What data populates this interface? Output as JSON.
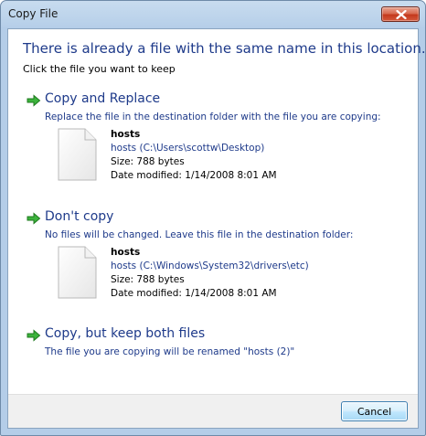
{
  "window": {
    "title": "Copy File"
  },
  "header": {
    "heading": "There is already a file with the same name in this location.",
    "subheading": "Click the file you want to keep"
  },
  "options": [
    {
      "title": "Copy and Replace",
      "description": "Replace the file in the destination folder with the file you are copying:",
      "file": {
        "name": "hosts",
        "path": "hosts (C:\\Users\\scottw\\Desktop)",
        "size": "Size: 788 bytes",
        "modified": "Date modified: 1/14/2008 8:01 AM"
      }
    },
    {
      "title": "Don't copy",
      "description": "No files will be changed. Leave this file in the destination folder:",
      "file": {
        "name": "hosts",
        "path": "hosts (C:\\Windows\\System32\\drivers\\etc)",
        "size": "Size: 788 bytes",
        "modified": "Date modified: 1/14/2008 8:01 AM"
      }
    },
    {
      "title": "Copy, but keep both files",
      "description": "The file you are copying will be renamed \"hosts (2)\""
    }
  ],
  "footer": {
    "cancel_label": "Cancel"
  },
  "colors": {
    "link_blue": "#1e3a8a",
    "arrow_green": "#2e9e2e",
    "close_red": "#c4391d"
  },
  "icons": {
    "close": "close-icon",
    "arrow": "green-arrow-icon",
    "file": "file-icon"
  }
}
